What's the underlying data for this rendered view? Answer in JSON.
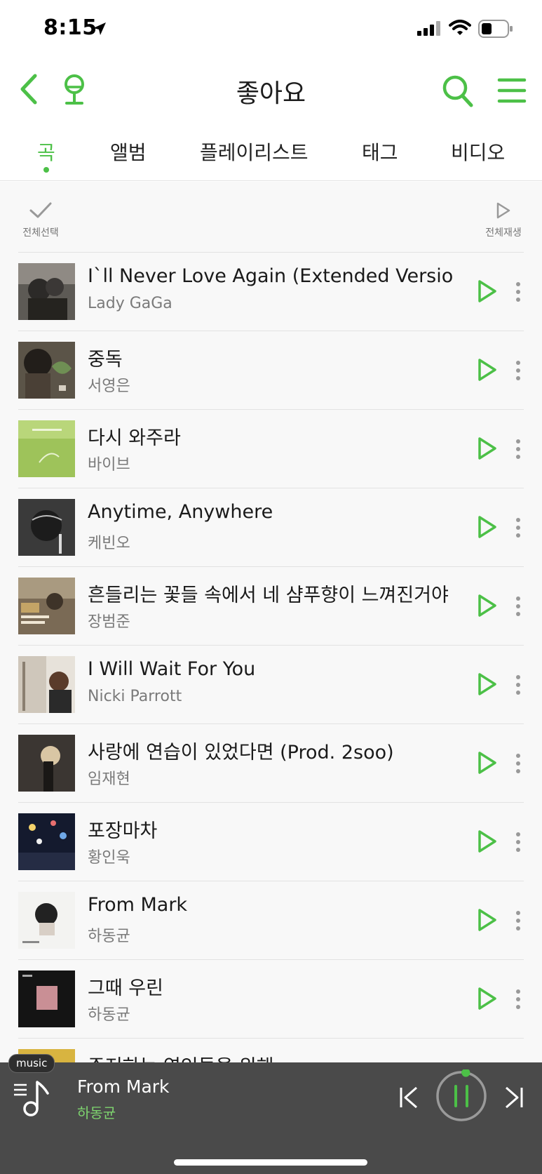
{
  "status_bar": {
    "time": "8:15"
  },
  "header": {
    "title": "좋아요"
  },
  "tabs": [
    {
      "label": "곡",
      "active": true
    },
    {
      "label": "앨범",
      "active": false
    },
    {
      "label": "플레이리스트",
      "active": false
    },
    {
      "label": "태그",
      "active": false
    },
    {
      "label": "비디오",
      "active": false
    }
  ],
  "list_controls": {
    "select_all_label": "전체선택",
    "play_all_label": "전체재생"
  },
  "songs": [
    {
      "title": "I`ll Never Love Again (Extended Version)",
      "artist": "Lady GaGa"
    },
    {
      "title": "중독",
      "artist": "서영은"
    },
    {
      "title": "다시 와주라",
      "artist": "바이브"
    },
    {
      "title": "Anytime, Anywhere",
      "artist": "케빈오"
    },
    {
      "title": "흔들리는 꽃들 속에서 네 샴푸향이 느껴진거야",
      "artist": "장범준"
    },
    {
      "title": "I Will Wait For You",
      "artist": "Nicki Parrott"
    },
    {
      "title": "사랑에 연습이 있었다면 (Prod. 2soo)",
      "artist": "임재현"
    },
    {
      "title": "포장마차",
      "artist": "황인욱"
    },
    {
      "title": "From Mark",
      "artist": "하동균"
    },
    {
      "title": "그때 우린",
      "artist": "하동균"
    },
    {
      "title": "주저하는 연인들을 위해",
      "artist": ""
    }
  ],
  "player": {
    "badge": "music",
    "title": "From Mark",
    "artist": "하동균",
    "progress": 0.03
  },
  "colors": {
    "accent": "#4cc047",
    "player_bg": "#4a4a4a",
    "player_artist": "#7ed46f"
  },
  "icons": [
    "back-icon",
    "mic-icon",
    "search-icon",
    "menu-icon",
    "check-icon",
    "play-icon",
    "more-icon",
    "music-queue-icon",
    "prev-icon",
    "pause-icon",
    "next-icon"
  ]
}
